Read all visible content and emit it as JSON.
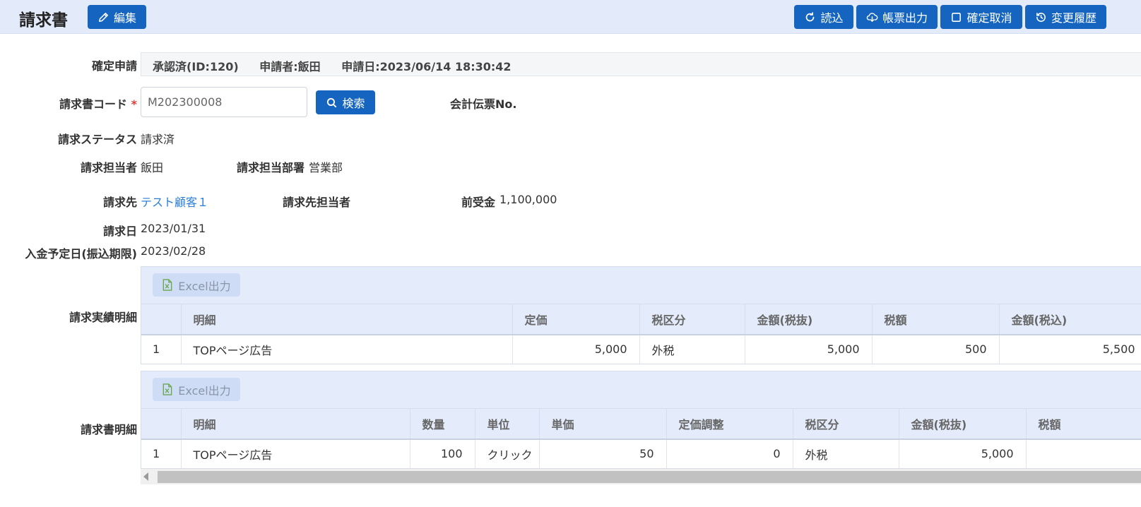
{
  "header": {
    "title": "請求書",
    "edit_label": "編集",
    "load_label": "読込",
    "form_output_label": "帳票出力",
    "confirm_cancel_label": "確定取消",
    "history_label": "変更履歴"
  },
  "form": {
    "confirm_label": "確定申請",
    "confirm_status": "承認済(ID:120)",
    "applicant": "申請者:飯田",
    "apply_date": "申請日:2023/06/14 18:30:42",
    "code_label": "請求書コード",
    "required_mark": "*",
    "code_value": "M202300008",
    "search_label": "検索",
    "voucher_label": "会計伝票No.",
    "status_label": "請求ステータス",
    "status_value": "請求済",
    "person_label": "請求担当者",
    "person_value": "飯田",
    "dept_label": "請求担当部署",
    "dept_value": "営業部",
    "client_label": "請求先",
    "client_value": "テスト顧客１",
    "client_person_label": "請求先担当者",
    "advance_label": "前受金",
    "advance_value": "1,100,000",
    "date_label": "請求日",
    "date_value": "2023/01/31",
    "due_label": "入金予定日(振込期限)",
    "due_value": "2023/02/28"
  },
  "results": {
    "label": "請求実績明細",
    "excel_label": "Excel出力",
    "columns": [
      "",
      "明細",
      "定価",
      "税区分",
      "金額(税抜)",
      "税額",
      "金額(税込)"
    ],
    "rows": [
      [
        "1",
        "TOPページ広告",
        "5,000",
        "外税",
        "5,000",
        "500",
        "5,500"
      ]
    ]
  },
  "details": {
    "label": "請求書明細",
    "excel_label": "Excel出力",
    "columns": [
      "",
      "明細",
      "数量",
      "単位",
      "単価",
      "定価調整",
      "税区分",
      "金額(税抜)",
      "税額"
    ],
    "rows": [
      [
        "1",
        "TOPページ広告",
        "100",
        "クリック",
        "50",
        "0",
        "外税",
        "5,000",
        ""
      ]
    ]
  },
  "colors": {
    "primary": "#1565c0",
    "header_bg": "#e3ebfb",
    "link": "#2a7fd4",
    "required": "#e53935"
  }
}
